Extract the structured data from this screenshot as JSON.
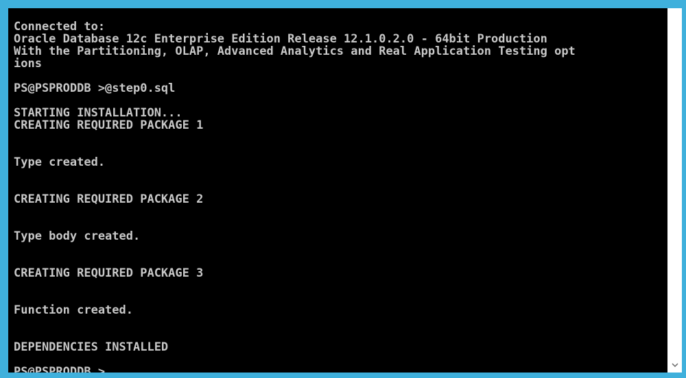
{
  "console": {
    "lines": [
      "Connected to:",
      "Oracle Database 12c Enterprise Edition Release 12.1.0.2.0 - 64bit Production",
      "With the Partitioning, OLAP, Advanced Analytics and Real Application Testing opt",
      "ions",
      "",
      "PS@PSPRODDB >@step0.sql",
      "",
      "STARTING INSTALLATION...",
      "CREATING REQUIRED PACKAGE 1",
      "",
      "",
      "Type created.",
      "",
      "",
      "CREATING REQUIRED PACKAGE 2",
      "",
      "",
      "Type body created.",
      "",
      "",
      "CREATING REQUIRED PACKAGE 3",
      "",
      "",
      "Function created.",
      "",
      "",
      "DEPENDENCIES INSTALLED",
      "",
      "PS@PSPRODDB >"
    ]
  },
  "colors": {
    "frame": "#3fb0dc",
    "background": "#000000",
    "text": "#c8c8c8"
  },
  "scrollbar": {
    "down_icon": "chevron-down-icon"
  }
}
